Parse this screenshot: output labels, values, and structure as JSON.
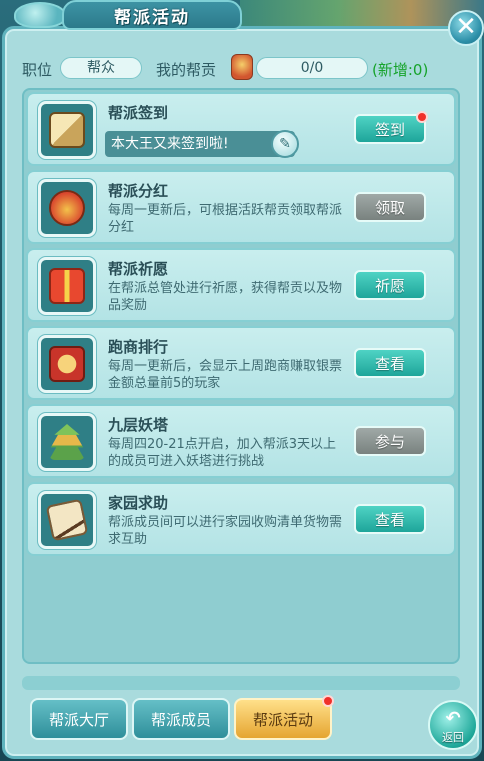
{
  "window": {
    "title": "帮派活动"
  },
  "info": {
    "position_label": "职位",
    "position_value": "帮众",
    "contrib_label": "我的帮贡",
    "contrib_value": "0/0",
    "new_added": "(新增:0)"
  },
  "activities": [
    {
      "title": "帮派签到",
      "input_value": "本大王又来签到啦!",
      "button": "签到",
      "button_style": "teal",
      "badge": true,
      "icon": "scroll-book-icon"
    },
    {
      "title": "帮派分红",
      "desc": "每周一更新后，可根据活跃帮贡领取帮派分红",
      "button": "领取",
      "button_style": "gray",
      "icon": "money-bag-icon"
    },
    {
      "title": "帮派祈愿",
      "desc": "在帮派总管处进行祈愿，获得帮贡以及物品奖励",
      "button": "祈愿",
      "button_style": "teal",
      "icon": "gift-box-icon"
    },
    {
      "title": "跑商排行",
      "desc": "每周一更新后，会显示上周跑商赚取银票金额总量前5的玩家",
      "button": "查看",
      "button_style": "teal",
      "icon": "ranking-badge-icon"
    },
    {
      "title": "九层妖塔",
      "desc": "每周四20-21点开启，加入帮派3天以上的成员可进入妖塔进行挑战",
      "button": "参与",
      "button_style": "gray",
      "icon": "pagoda-icon"
    },
    {
      "title": "家园求助",
      "desc": "帮派成员间可以进行家园收购清单货物需求互助",
      "button": "查看",
      "button_style": "teal",
      "icon": "scroll-quill-icon"
    }
  ],
  "tabs": [
    {
      "label": "帮派大厅",
      "active": false
    },
    {
      "label": "帮派成员",
      "active": false
    },
    {
      "label": "帮派活动",
      "active": true,
      "badge": true
    }
  ],
  "back": {
    "label": "返回",
    "icon": "back-arrow-icon"
  },
  "close": {
    "icon": "close-icon"
  },
  "colors": {
    "accent_teal": "#1ea59a",
    "panel_bg": "#a9dbdd",
    "new_green": "#16a32a",
    "badge_red": "#f0302a"
  }
}
